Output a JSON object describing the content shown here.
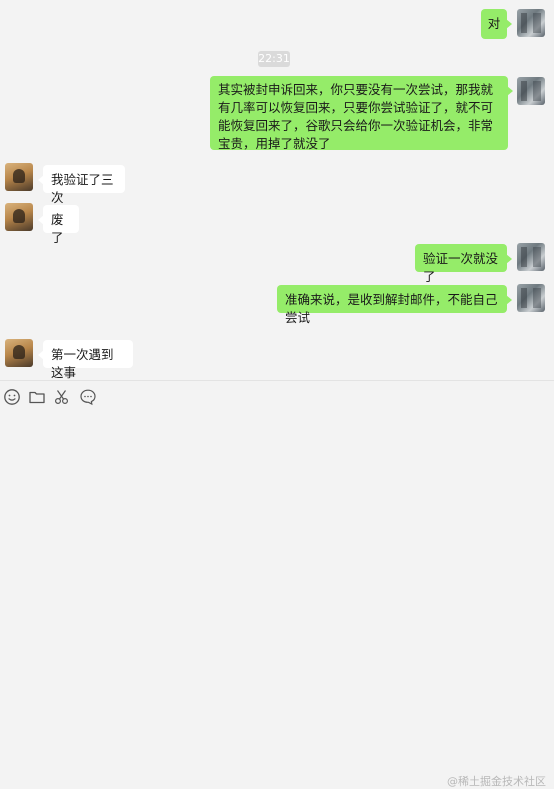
{
  "messages": [
    {
      "side": "right",
      "text": "对"
    },
    {
      "type": "time",
      "text": "22:31"
    },
    {
      "side": "right",
      "text": "其实被封申诉回来，你只要没有一次尝试，那我就有几率可以恢复回来，只要你尝试验证了，就不可能恢复回来了，谷歌只会给你一次验证机会，非常宝贵，用掉了就没了"
    },
    {
      "side": "left",
      "text": "我验证了三次"
    },
    {
      "side": "left",
      "text": "废了"
    },
    {
      "side": "right",
      "text": "验证一次就没了"
    },
    {
      "side": "right",
      "text": "准确来说，是收到解封邮件，不能自己尝试"
    },
    {
      "side": "left",
      "text": "第一次遇到这事"
    }
  ],
  "toolbar": {
    "icons": [
      "emoji-icon",
      "folder-icon",
      "scissors-icon",
      "chat-bubble-icon"
    ]
  },
  "watermark": "@稀土掘金技术社区"
}
